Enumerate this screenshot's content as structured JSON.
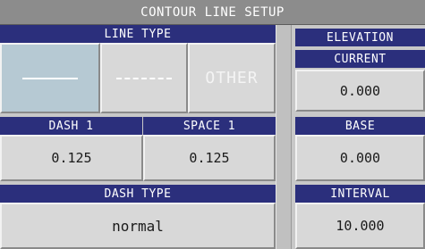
{
  "title": "CONTOUR LINE SETUP",
  "line_type": {
    "header": "LINE TYPE",
    "options": [
      {
        "id": "solid",
        "label": "",
        "selected": true
      },
      {
        "id": "dashed",
        "label": "",
        "selected": false
      },
      {
        "id": "other",
        "label": "OTHER",
        "selected": false
      }
    ]
  },
  "dash1": {
    "header": "DASH 1",
    "value": "0.125"
  },
  "space1": {
    "header": "SPACE 1",
    "value": "0.125"
  },
  "dash_type": {
    "header": "DASH TYPE",
    "value": "normal"
  },
  "elevation": {
    "header": "ELEVATION",
    "current": {
      "label": "CURRENT",
      "value": "0.000"
    },
    "base": {
      "label": "BASE",
      "value": "0.000"
    },
    "interval": {
      "label": "INTERVAL",
      "value": "10.000"
    }
  },
  "colors": {
    "header_bg": "#2b2f7c",
    "title_bg": "#8c8c8c",
    "button_bg": "#d8d8d8",
    "selected_bg": "#b6c9d3"
  }
}
